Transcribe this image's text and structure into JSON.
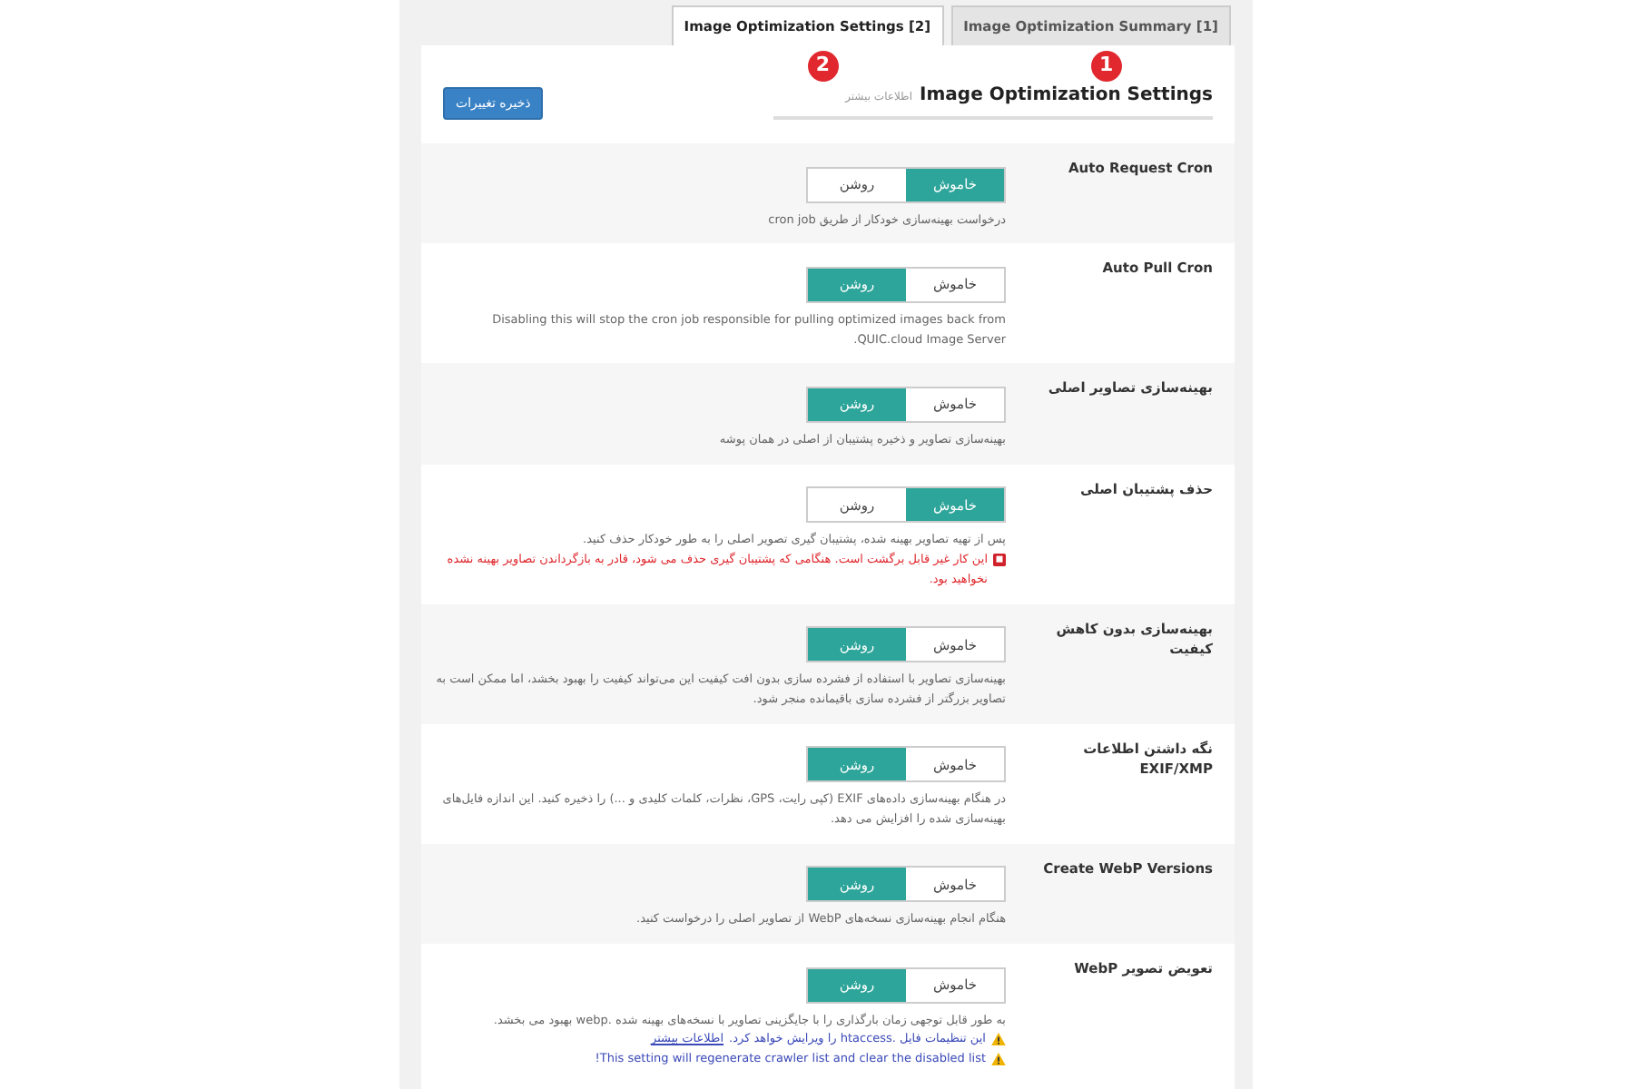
{
  "tabs": [
    {
      "label": "Image Optimization Summary [1]",
      "selected": false,
      "annotation": "1"
    },
    {
      "label": "Image Optimization Settings [2]",
      "selected": true,
      "annotation": "2"
    }
  ],
  "heading": {
    "title": "Image Optimization Settings",
    "link": "اطلاعات بیشتر"
  },
  "save_button": "ذخیره تغییرات",
  "rows": [
    {
      "label": "Auto Request Cron",
      "off_label": "خاموش",
      "on_label": "روشن",
      "on": false,
      "notes": [
        {
          "kind": "text",
          "text": "درخواست بهینه‌سازی خودکار از طریق cron job"
        }
      ]
    },
    {
      "label": "Auto Pull Cron",
      "off_label": "خاموش",
      "on_label": "روشن",
      "on": true,
      "notes": [
        {
          "kind": "text",
          "text": "Disabling this will stop the cron job responsible for pulling optimized images back from QUIC.cloud Image Server."
        }
      ]
    },
    {
      "label": "بهینه‌سازی تصاویر اصلی",
      "off_label": "خاموش",
      "on_label": "روشن",
      "on": true,
      "notes": [
        {
          "kind": "text",
          "text": "بهینه‌سازی تصاویر و ذخیره پشتیبان از اصلی در همان پوشه"
        }
      ]
    },
    {
      "label": "حذف پشتیبان اصلی",
      "off_label": "خاموش",
      "on_label": "روشن",
      "on": false,
      "notes": [
        {
          "kind": "text",
          "text": "پس از تهیه تصاویر بهینه شده، پشتیبان گیری تصویر اصلی را به طور خودکار حذف کنید."
        },
        {
          "kind": "danger",
          "text": "این کار غیر قابل برگشت است. هنگامی که پشتیبان گیری حذف می شود، قادر به بازگرداندن تصاویر بهینه نشده نخواهید بود."
        }
      ]
    },
    {
      "label": "بهینه‌سازی بدون کاهش کیفیت",
      "off_label": "خاموش",
      "on_label": "روشن",
      "on": true,
      "notes": [
        {
          "kind": "text",
          "text": "بهینه‌سازی تصاویر با استفاده از فشرده سازی بدون افت کیفیت این می‌تواند کیفیت را بهبود بخشد، اما ممکن است به تصاویر بزرگتر از فشرده سازی باقیمانده منجر شود."
        }
      ]
    },
    {
      "label": "نگه داشتن اطلاعات EXIF/XMP",
      "off_label": "خاموش",
      "on_label": "روشن",
      "on": true,
      "notes": [
        {
          "kind": "text",
          "text": "در هنگام بهینه‌سازی داده‌های EXIF (کپی رایت، GPS، نظرات، کلمات کلیدی و ...) را ذخیره کنید. این اندازه فایل‌های بهینه‌سازی شده را افزایش می دهد."
        }
      ]
    },
    {
      "label": "Create WebP Versions",
      "off_label": "خاموش",
      "on_label": "روشن",
      "on": true,
      "notes": [
        {
          "kind": "text",
          "text": "هنگام انجام بهینه‌سازی نسخه‌های WebP از تصاویر اصلی را درخواست کنید."
        }
      ]
    },
    {
      "label": "تعویض تصویر WebP",
      "off_label": "خاموش",
      "on_label": "روشن",
      "on": true,
      "notes": [
        {
          "kind": "text",
          "text": "به طور قابل توجهی زمان بارگذاری را با جایگزینی تصاویر با نسخه‌های بهینه شده .webp بهبود می بخشد."
        },
        {
          "kind": "warning",
          "text": "این تنظیمات فایل .htaccess را ویرایش خواهد کرد.",
          "link": "اطلاعات بیشتر"
        },
        {
          "kind": "warning",
          "text": "This setting will regenerate crawler list and clear the disabled list!"
        }
      ]
    }
  ]
}
